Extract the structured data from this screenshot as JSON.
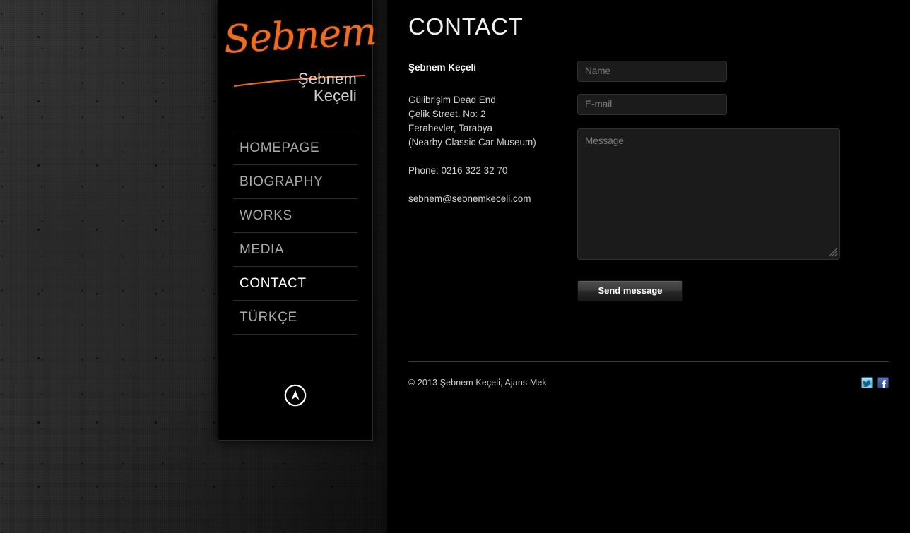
{
  "sidebar": {
    "logo": {
      "script_text": "Sebnem",
      "name_line1": "Şebnem",
      "name_line2": "Keçeli",
      "accent_color": "#ef6d22"
    },
    "nav": [
      {
        "label": "HOMEPAGE",
        "active": false
      },
      {
        "label": "BIOGRAPHY",
        "active": false
      },
      {
        "label": "WORKS",
        "active": false
      },
      {
        "label": "MEDIA",
        "active": false
      },
      {
        "label": "CONTACT",
        "active": true
      },
      {
        "label": "TÜRKÇE",
        "active": false
      }
    ],
    "scroll_top_icon": "circle-up-arrow-icon"
  },
  "main": {
    "page_title": "CONTACT",
    "contact_info": {
      "name": "Şebnem Keçeli",
      "address_lines": [
        "Gülibrişim Dead End",
        "Çelik Street. No: 2",
        "Ferahevler, Tarabya",
        "(Nearby Classic Car Museum)"
      ],
      "phone": "Phone: 0216 322 32 70",
      "email": "sebnem@sebnemkeceli.com"
    },
    "form": {
      "name_placeholder": "Name",
      "name_value": "",
      "email_placeholder": "E-mail",
      "email_value": "",
      "message_placeholder": "Message",
      "message_value": "",
      "submit_label": "Send message"
    }
  },
  "footer": {
    "copyright": "© 2013 Şebnem Keçeli, Ajans Mek",
    "social": [
      {
        "name": "twitter",
        "color": "#3fb3e2"
      },
      {
        "name": "facebook",
        "color": "#3b5998"
      }
    ]
  }
}
